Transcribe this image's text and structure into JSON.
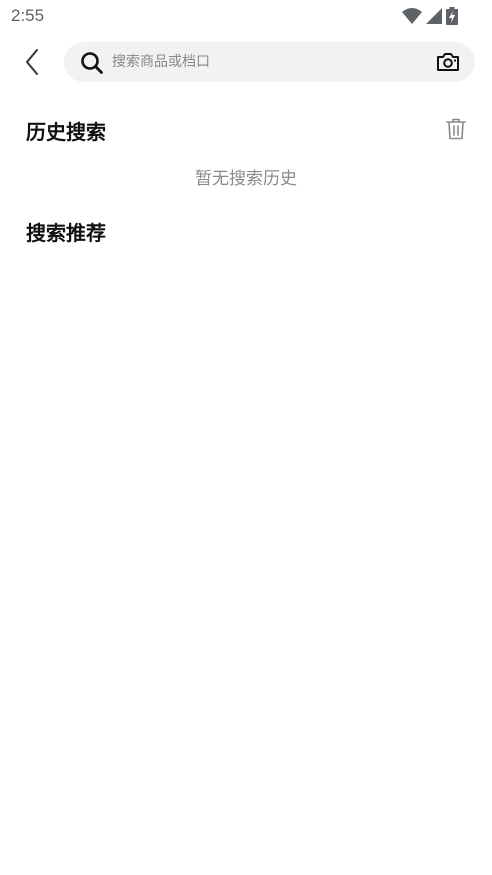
{
  "status_bar": {
    "time": "2:55",
    "icons": [
      "wifi-icon",
      "cellular-signal-icon",
      "battery-charging-icon"
    ]
  },
  "search": {
    "placeholder": "搜索商品或档口",
    "value": "",
    "back_icon": "chevron-left-icon",
    "search_icon": "search-icon",
    "camera_icon": "camera-icon"
  },
  "history": {
    "title": "历史搜索",
    "empty_text": "暂无搜索历史",
    "clear_icon": "trash-icon"
  },
  "recommend": {
    "title": "搜索推荐"
  },
  "colors": {
    "background": "#ffffff",
    "search_box": "#f2f2f2",
    "muted_text": "#8a8a8a",
    "heading": "#111111"
  }
}
